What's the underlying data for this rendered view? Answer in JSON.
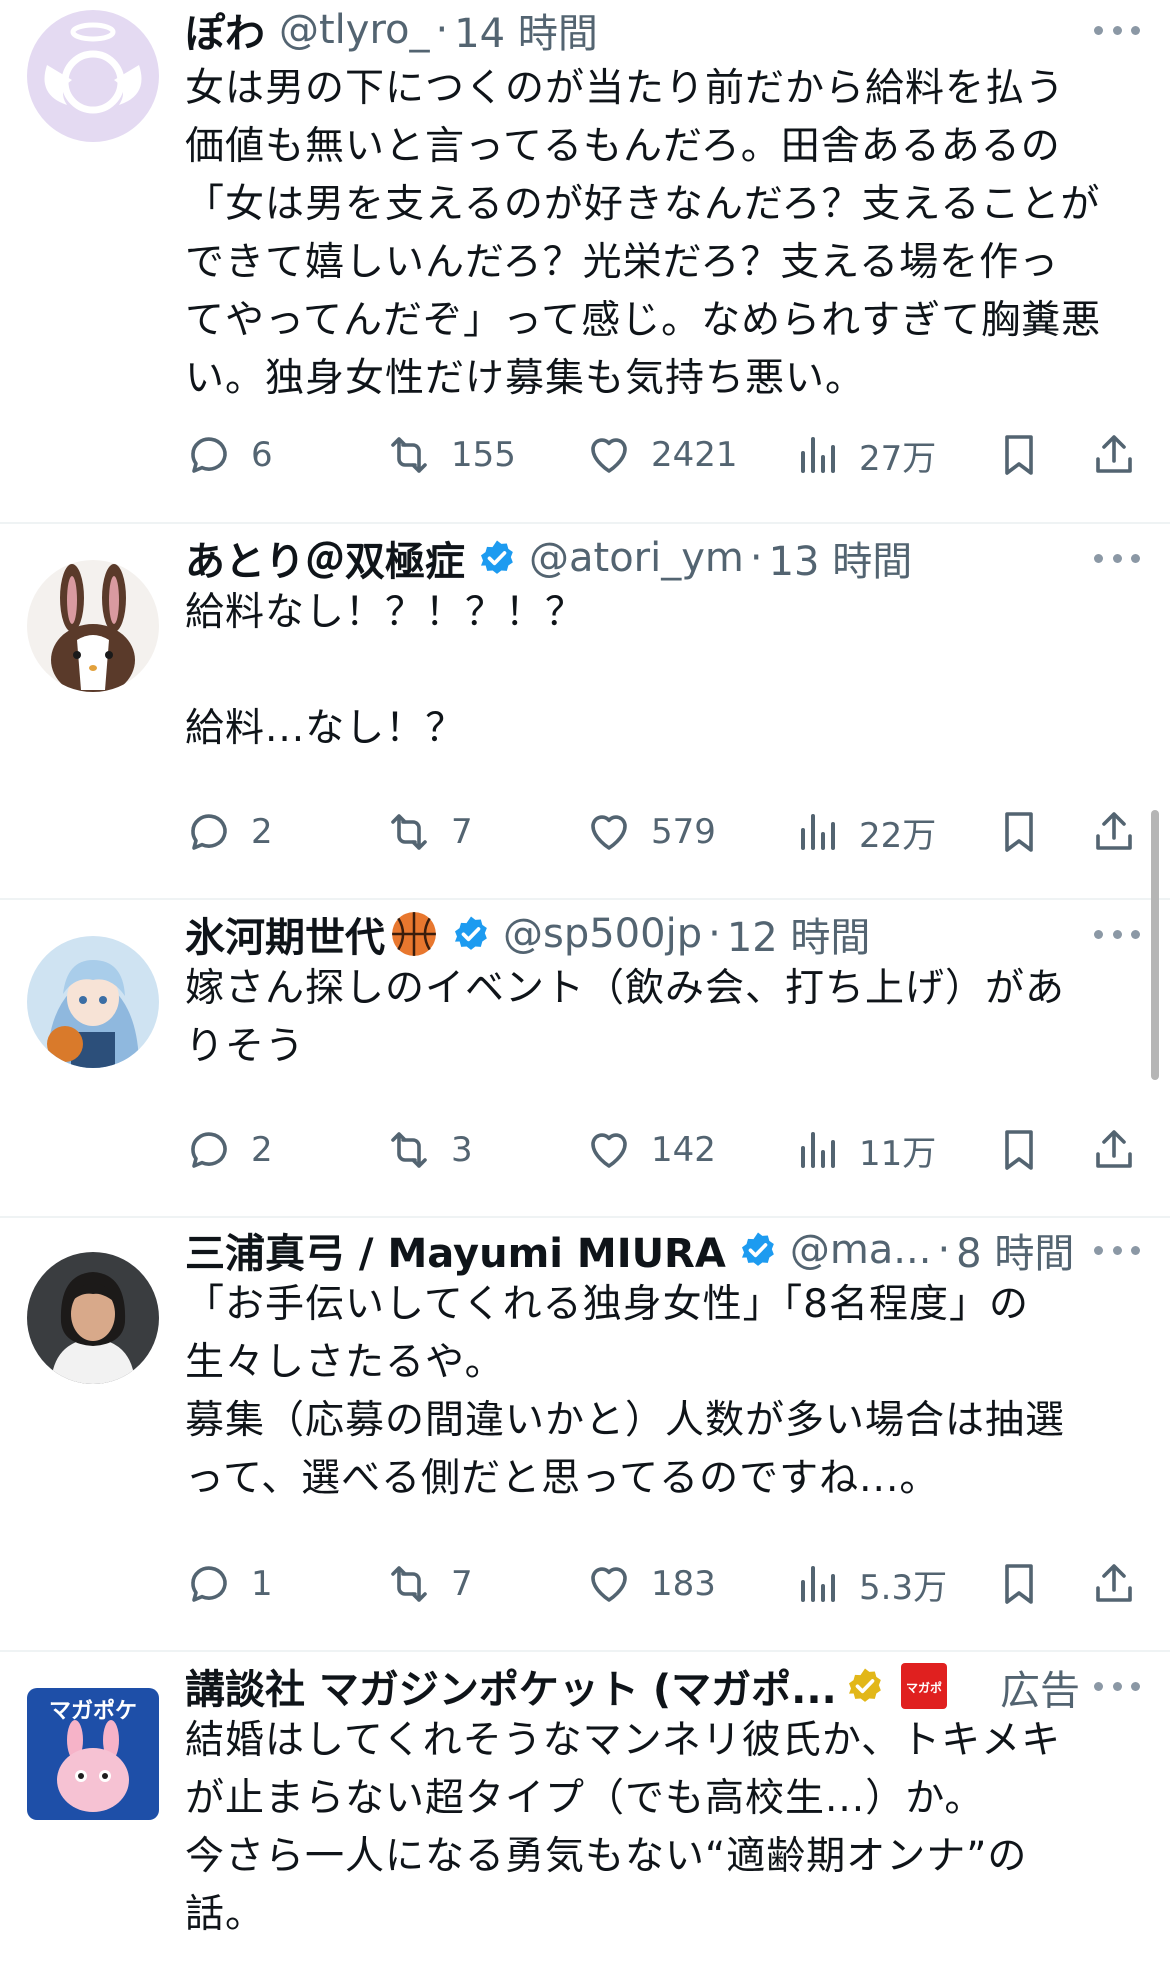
{
  "tweets": [
    {
      "name": "ぽわ",
      "handle": "@tlyro_",
      "separator": "·",
      "time": "14 時間",
      "text": "女は男の下につくのが当たり前だから給料を払う\n価値も無いと言ってるもんだろ。田舎あるあるの\n「女は男を支えるのが好きなんだろ？支えることが\nできて嬉しいんだろ？光栄だろ？支える場を作っ\nてやってんだぞ」って感じ。なめられすぎて胸糞悪\nい。独身女性だけ募集も気持ち悪い。",
      "replies": "6",
      "reposts": "155",
      "likes": "2421",
      "views": "27万"
    },
    {
      "name": "あとり＠双極症",
      "handle": "@atori_ym",
      "separator": "·",
      "time": "13 時間",
      "text": "給料なし！？！？！？\n\n給料...なし！？",
      "replies": "2",
      "reposts": "7",
      "likes": "579",
      "views": "22万"
    },
    {
      "name": "氷河期世代",
      "handle": "@sp500jp",
      "separator": "·",
      "time": "12 時間",
      "text": "嫁さん探しのイベント（飲み会、打ち上げ）があ\nりそう",
      "replies": "2",
      "reposts": "3",
      "likes": "142",
      "views": "11万"
    },
    {
      "name": "三浦真弓 / Mayumi MIURA",
      "handle": "@ma...",
      "separator": "·",
      "time": "8 時間",
      "text": "「お手伝いしてくれる独身女性」「8名程度」の\n生々しさたるや。\n募集（応募の間違いかと）人数が多い場合は抽選\nって、選べる側だと思ってるのですね...。",
      "replies": "1",
      "reposts": "7",
      "likes": "183",
      "views": "5.3万"
    },
    {
      "name": "講談社 マガジンポケット (マガポ...",
      "ad_label": "広告",
      "avatar_text": "マガポケ",
      "badge_text": "マガポ",
      "text": "結婚はしてくれそうなマンネリ彼氏か、トキメキ\nが止まらない超タイプ（でも高校生...）か。\n今さら一人になる勇気もない“適齢期オンナ”の\n話。"
    }
  ],
  "colors": {
    "verified_blue": "#1d9bf0",
    "verified_gold": "#e2b719",
    "muted": "#536471"
  }
}
